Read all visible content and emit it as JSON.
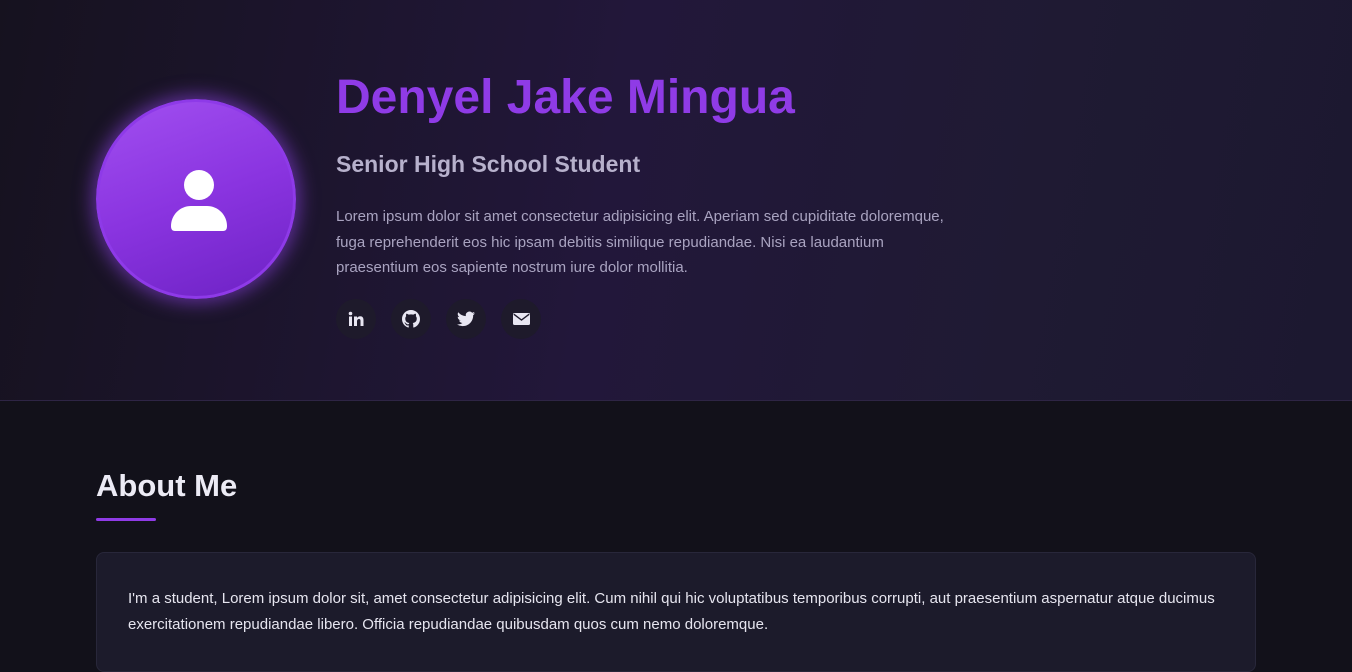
{
  "profile": {
    "name": "Denyel Jake Mingua",
    "role": "Senior High School Student",
    "bio": "Lorem ipsum dolor sit amet consectetur adipisicing elit. Aperiam sed cupiditate doloremque, fuga reprehenderit eos hic ipsam debitis similique repudiandae. Nisi ea laudantium praesentium eos sapiente nostrum iure dolor mollitia.",
    "avatar_icon": "user-icon"
  },
  "socials": [
    {
      "icon": "linkedin-icon"
    },
    {
      "icon": "github-icon"
    },
    {
      "icon": "twitter-icon"
    },
    {
      "icon": "envelope-icon"
    }
  ],
  "about": {
    "title": "About Me",
    "text": "I'm a student, Lorem ipsum dolor sit, amet consectetur adipisicing elit. Cum nihil qui hic voluptatibus temporibus corrupti, aut praesentium aspernatur atque ducimus exercitationem repudiandae libero. Officia repudiandae quibusdam quos cum nemo doloremque."
  },
  "colors": {
    "accent": "#8f3be6",
    "background": "#12111a",
    "hero_background": "#22173a",
    "card_background": "#1c1b2b",
    "heading_text": "#ecebf5",
    "muted_text": "#a9a3c0"
  }
}
